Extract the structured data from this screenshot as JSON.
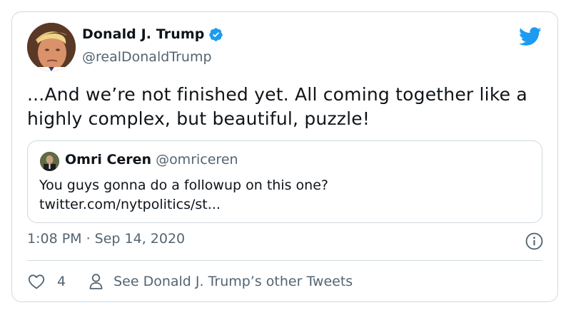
{
  "author": {
    "name": "Donald J. Trump",
    "handle": "@realDonaldTrump",
    "verified": true,
    "avatar_icon": "avatar-photo"
  },
  "tweet": {
    "text": "...And we’re not finished yet. All coming together like a highly complex, but beautiful, puzzle!"
  },
  "quoted_tweet": {
    "name": "Omri Ceren",
    "handle": "@omriceren",
    "text_line1": "You guys gonna do a followup on this one?",
    "text_line2": "twitter.com/nytpolitics/st..."
  },
  "meta": {
    "timestamp": "1:08 PM · Sep 14, 2020"
  },
  "actions": {
    "like_count": "4",
    "profile_link": "See Donald J. Trump’s other Tweets"
  },
  "colors": {
    "twitter_blue": "#1d9bf0",
    "secondary_text": "#536471",
    "border": "#cfd9de"
  }
}
